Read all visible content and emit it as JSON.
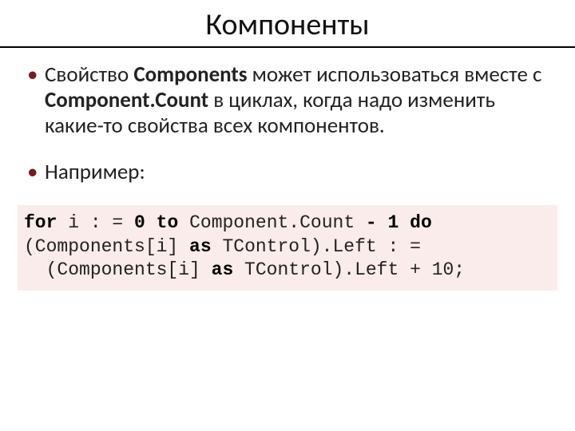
{
  "title": "Компоненты",
  "bullet1": {
    "t1": "Свойство ",
    "b1": "Components",
    "t2": " может использоваться вместе с ",
    "b2": "Component.Count",
    "t3": " в циклах, когда надо изменить какие-то свойства всех компонентов."
  },
  "bullet2": "Например:",
  "code": {
    "l1a": "for",
    "l1b": " i : = ",
    "l1c": "0",
    "l1d": " to",
    "l1e": " Component.Count ",
    "l1f": "- 1",
    "l1g": " do",
    "l2a": "(Components[i] ",
    "l2b": "as",
    "l2c": " TControl).Left : =",
    "l3a": "  (Components[i] ",
    "l3b": "as",
    "l3c": " TControl).Left + 10;"
  }
}
